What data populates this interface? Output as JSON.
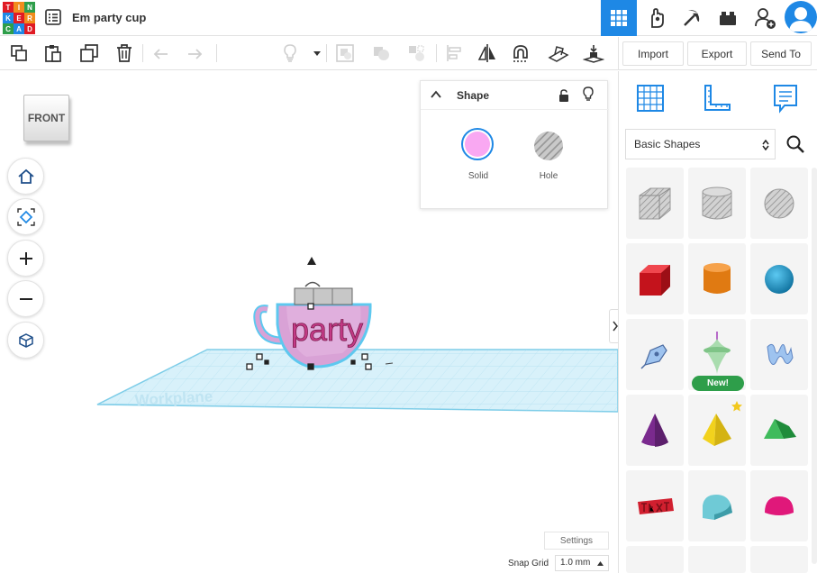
{
  "app": {
    "logo_letters": [
      "T",
      "I",
      "N",
      "K",
      "E",
      "R",
      "C",
      "A",
      "D"
    ],
    "design_title": "Em party cup"
  },
  "topbar": {
    "icons": [
      "grid-view-icon",
      "brick-hand-icon",
      "pickaxe-icon",
      "lego-brick-icon",
      "add-user-icon",
      "avatar-icon"
    ],
    "active_icon": "grid-view-icon"
  },
  "toolbar": {
    "tools": [
      "copy",
      "paste",
      "duplicate",
      "delete",
      "undo",
      "redo",
      "light",
      "group",
      "ungroup",
      "align",
      "flip",
      "cruise",
      "workplane",
      "drop"
    ]
  },
  "right_header": {
    "import_label": "Import",
    "export_label": "Export",
    "send_to_label": "Send To"
  },
  "viewcube": {
    "label": "FRONT"
  },
  "shape_panel": {
    "title": "Shape",
    "solid_label": "Solid",
    "hole_label": "Hole",
    "solid_color": "#f9a8f2"
  },
  "scene": {
    "object_text": "party",
    "workplane_text": "Workplane"
  },
  "settings": {
    "settings_label": "Settings",
    "snap_grid_label": "Snap Grid",
    "snap_grid_value": "1.0 mm"
  },
  "library": {
    "selected": "Basic Shapes",
    "new_badge": "New!",
    "shapes": [
      {
        "name": "box-hole",
        "color": "#c8c8c8"
      },
      {
        "name": "cylinder-hole",
        "color": "#c8c8c8"
      },
      {
        "name": "sphere-hole",
        "color": "#c8c8c8"
      },
      {
        "name": "box",
        "color": "#e01b24"
      },
      {
        "name": "cylinder",
        "color": "#f28c1d"
      },
      {
        "name": "sphere",
        "color": "#1aa0d6"
      },
      {
        "name": "scribble",
        "color": "#8ab4e8"
      },
      {
        "name": "shape-generator",
        "color": "#9fd8a4"
      },
      {
        "name": "text",
        "color": "#8ab4e8"
      },
      {
        "name": "cone",
        "color": "#8a2e9a"
      },
      {
        "name": "pyramid",
        "color": "#f2d21d"
      },
      {
        "name": "roof",
        "color": "#2ea84a"
      },
      {
        "name": "text-3d",
        "color": "#d11f2f"
      },
      {
        "name": "round-roof",
        "color": "#6fcad6"
      },
      {
        "name": "half-sphere",
        "color": "#e0187a"
      }
    ]
  }
}
